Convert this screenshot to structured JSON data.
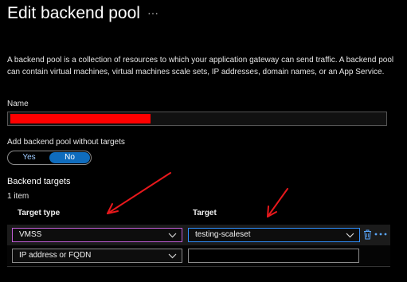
{
  "header": {
    "title": "Edit backend pool",
    "more_label": "···"
  },
  "description": "A backend pool is a collection of resources to which your application gateway can send traffic. A backend pool can contain virtual machines, virtual machines scale sets, IP addresses, domain names, or an App Service.",
  "name_field": {
    "label": "Name",
    "value": ""
  },
  "without_targets": {
    "label": "Add backend pool without targets",
    "options": [
      "Yes",
      "No"
    ],
    "selected": "No"
  },
  "targets": {
    "title": "Backend targets",
    "count": "1 item",
    "columns": [
      "Target type",
      "Target"
    ],
    "rows": [
      {
        "type": "VMSS",
        "target": "testing-scaleset"
      },
      {
        "type": "IP address or FQDN",
        "target": ""
      }
    ]
  },
  "colors": {
    "accent": "#0f6cbd",
    "annotation": "#e8181c",
    "focus_border": "#2f8fff",
    "type_border": "#c35ed8"
  },
  "icons": [
    "ellipsis-icon",
    "chevron-down-icon",
    "trash-icon"
  ]
}
